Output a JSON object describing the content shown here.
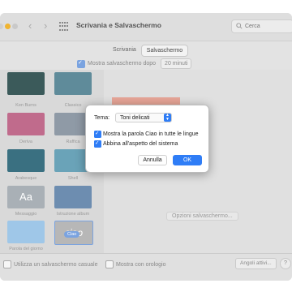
{
  "window": {
    "title": "Scrivania e Salvaschermo"
  },
  "search": {
    "placeholder": "Cerca"
  },
  "tabs": [
    {
      "label": "Scrivania"
    },
    {
      "label": "Salvaschermo"
    }
  ],
  "options": {
    "show_after_label": "Mostra salvaschermo dopo",
    "show_after_value": "20 minuti"
  },
  "savers": [
    {
      "label": "Ken Burns",
      "color": "#3b5a5a"
    },
    {
      "label": "Classico",
      "color": "#5f8b9a"
    },
    {
      "label": "Deriva",
      "color": "#c06b8c"
    },
    {
      "label": "Raffica",
      "color": "#8f9aa6"
    },
    {
      "label": "Arabesque",
      "color": "#3a7081"
    },
    {
      "label": "Shell",
      "color": "#6aa3b8"
    },
    {
      "label": "Messaggio",
      "color": "#a9b0b6",
      "glyph": "Aa"
    },
    {
      "label": "Istruzione album",
      "color": "#6d8db0"
    },
    {
      "label": "Parola del giorno",
      "color": "#9fc7e8"
    },
    {
      "label": "Ciao",
      "color": "#b7b7b7",
      "glyph": "ciao"
    }
  ],
  "preview": {
    "color": "#e6a597",
    "options_button": "Opzioni salvaschermo..."
  },
  "bottom": {
    "random_label": "Utilizza un salvaschermo casuale",
    "clock_label": "Mostra con orologio",
    "hot_corners": "Angoli attivi...",
    "help": "?"
  },
  "dialog": {
    "theme_label": "Tema:",
    "theme_value": "Toni delicati",
    "option1": "Mostra la parola Ciao in tutte le lingue",
    "option2": "Abbina all'aspetto del sistema",
    "cancel": "Annulla",
    "ok": "OK"
  }
}
